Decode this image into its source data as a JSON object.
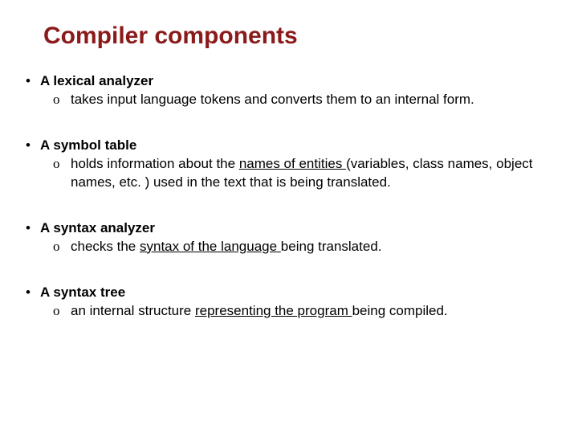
{
  "title": "Compiler components",
  "items": [
    {
      "term": "A lexical analyzer",
      "desc_pre": "takes input language tokens and converts them to an internal form.",
      "underline": "",
      "desc_post": ""
    },
    {
      "term": "A symbol table",
      "desc_pre": "holds information about the ",
      "underline": "names of entities ",
      "desc_post": "(variables, class names, object names, etc. ) used in the text that is being translated."
    },
    {
      "term": "A syntax analyzer",
      "desc_pre": "checks the ",
      "underline": "syntax of the language ",
      "desc_post": "being translated."
    },
    {
      "term": "A syntax tree",
      "desc_pre": "an internal structure ",
      "underline": "representing the program ",
      "desc_post": "being compiled."
    }
  ]
}
